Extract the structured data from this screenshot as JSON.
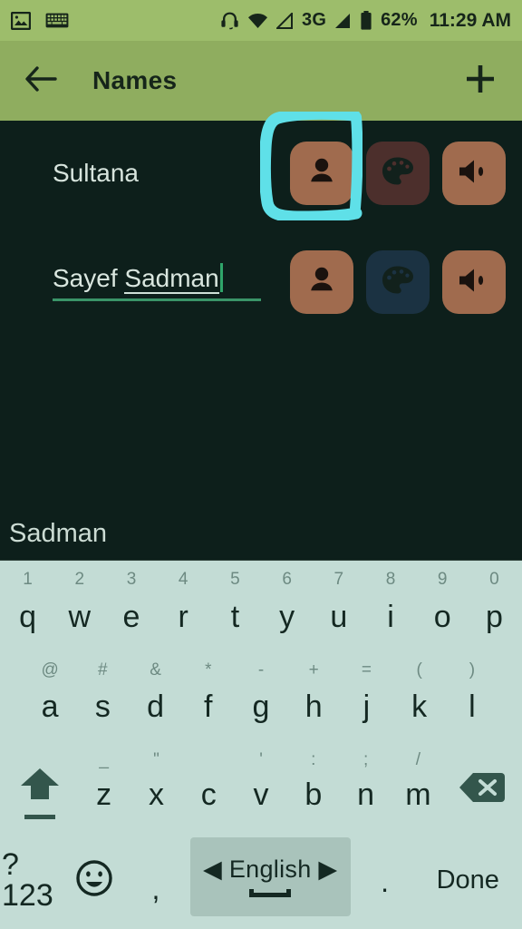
{
  "statusbar": {
    "icons": [
      "image-icon",
      "keyboard-icon",
      "headset-icon",
      "wifi-icon",
      "signal-icon"
    ],
    "network_label": "3G",
    "battery_percent": "62%",
    "time": "11:29 AM"
  },
  "appbar": {
    "back_icon": "arrow-left-icon",
    "title": "Names",
    "add_icon": "plus-icon"
  },
  "list": {
    "rows": [
      {
        "name": "Sultana",
        "editing": false,
        "buttons": [
          {
            "name": "person-button",
            "icon": "person-icon",
            "color": "#a06b4e"
          },
          {
            "name": "palette-button",
            "icon": "palette-icon",
            "color": "#4c2f2c"
          },
          {
            "name": "speaker-button",
            "icon": "speaker-icon",
            "color": "#a06b4e"
          }
        ]
      },
      {
        "name": "Sayef ",
        "name_composing": "Sadman",
        "editing": true,
        "buttons": [
          {
            "name": "person-button",
            "icon": "person-icon",
            "color": "#a06b4e"
          },
          {
            "name": "palette-button",
            "icon": "palette-icon",
            "color": "#1b3242"
          },
          {
            "name": "speaker-button",
            "icon": "speaker-icon",
            "color": "#a06b4e"
          }
        ]
      }
    ]
  },
  "annotation": {
    "type": "hand-drawn-highlight-box",
    "color": "#5fe0e8",
    "target": "row-1-person-button"
  },
  "keyboard": {
    "suggestion": "Sadman",
    "row1": [
      {
        "letter": "q",
        "hint": "1"
      },
      {
        "letter": "w",
        "hint": "2"
      },
      {
        "letter": "e",
        "hint": "3"
      },
      {
        "letter": "r",
        "hint": "4"
      },
      {
        "letter": "t",
        "hint": "5"
      },
      {
        "letter": "y",
        "hint": "6"
      },
      {
        "letter": "u",
        "hint": "7"
      },
      {
        "letter": "i",
        "hint": "8"
      },
      {
        "letter": "o",
        "hint": "9"
      },
      {
        "letter": "p",
        "hint": "0"
      }
    ],
    "row2": [
      {
        "letter": "a",
        "hint": "@"
      },
      {
        "letter": "s",
        "hint": "#"
      },
      {
        "letter": "d",
        "hint": "&"
      },
      {
        "letter": "f",
        "hint": "*"
      },
      {
        "letter": "g",
        "hint": "-"
      },
      {
        "letter": "h",
        "hint": "+"
      },
      {
        "letter": "j",
        "hint": "="
      },
      {
        "letter": "k",
        "hint": "("
      },
      {
        "letter": "l",
        "hint": ")"
      }
    ],
    "row3": [
      {
        "letter": "z",
        "hint": "_"
      },
      {
        "letter": "x",
        "hint": "\""
      },
      {
        "letter": "c",
        "hint": ""
      },
      {
        "letter": "v",
        "hint": "'"
      },
      {
        "letter": "b",
        "hint": ":"
      },
      {
        "letter": "n",
        "hint": ";"
      },
      {
        "letter": "m",
        "hint": "/"
      }
    ],
    "shift_icon": "shift-up-arrow-icon",
    "backspace_icon": "backspace-icon",
    "row4": {
      "symbols_key": "?123",
      "emoji_icon": "emoji-smiley-icon",
      "comma": ",",
      "space_label": "English",
      "space_prev_icon": "triangle-left-icon",
      "space_next_icon": "triangle-right-icon",
      "period": ".",
      "done_label": "Done"
    }
  }
}
